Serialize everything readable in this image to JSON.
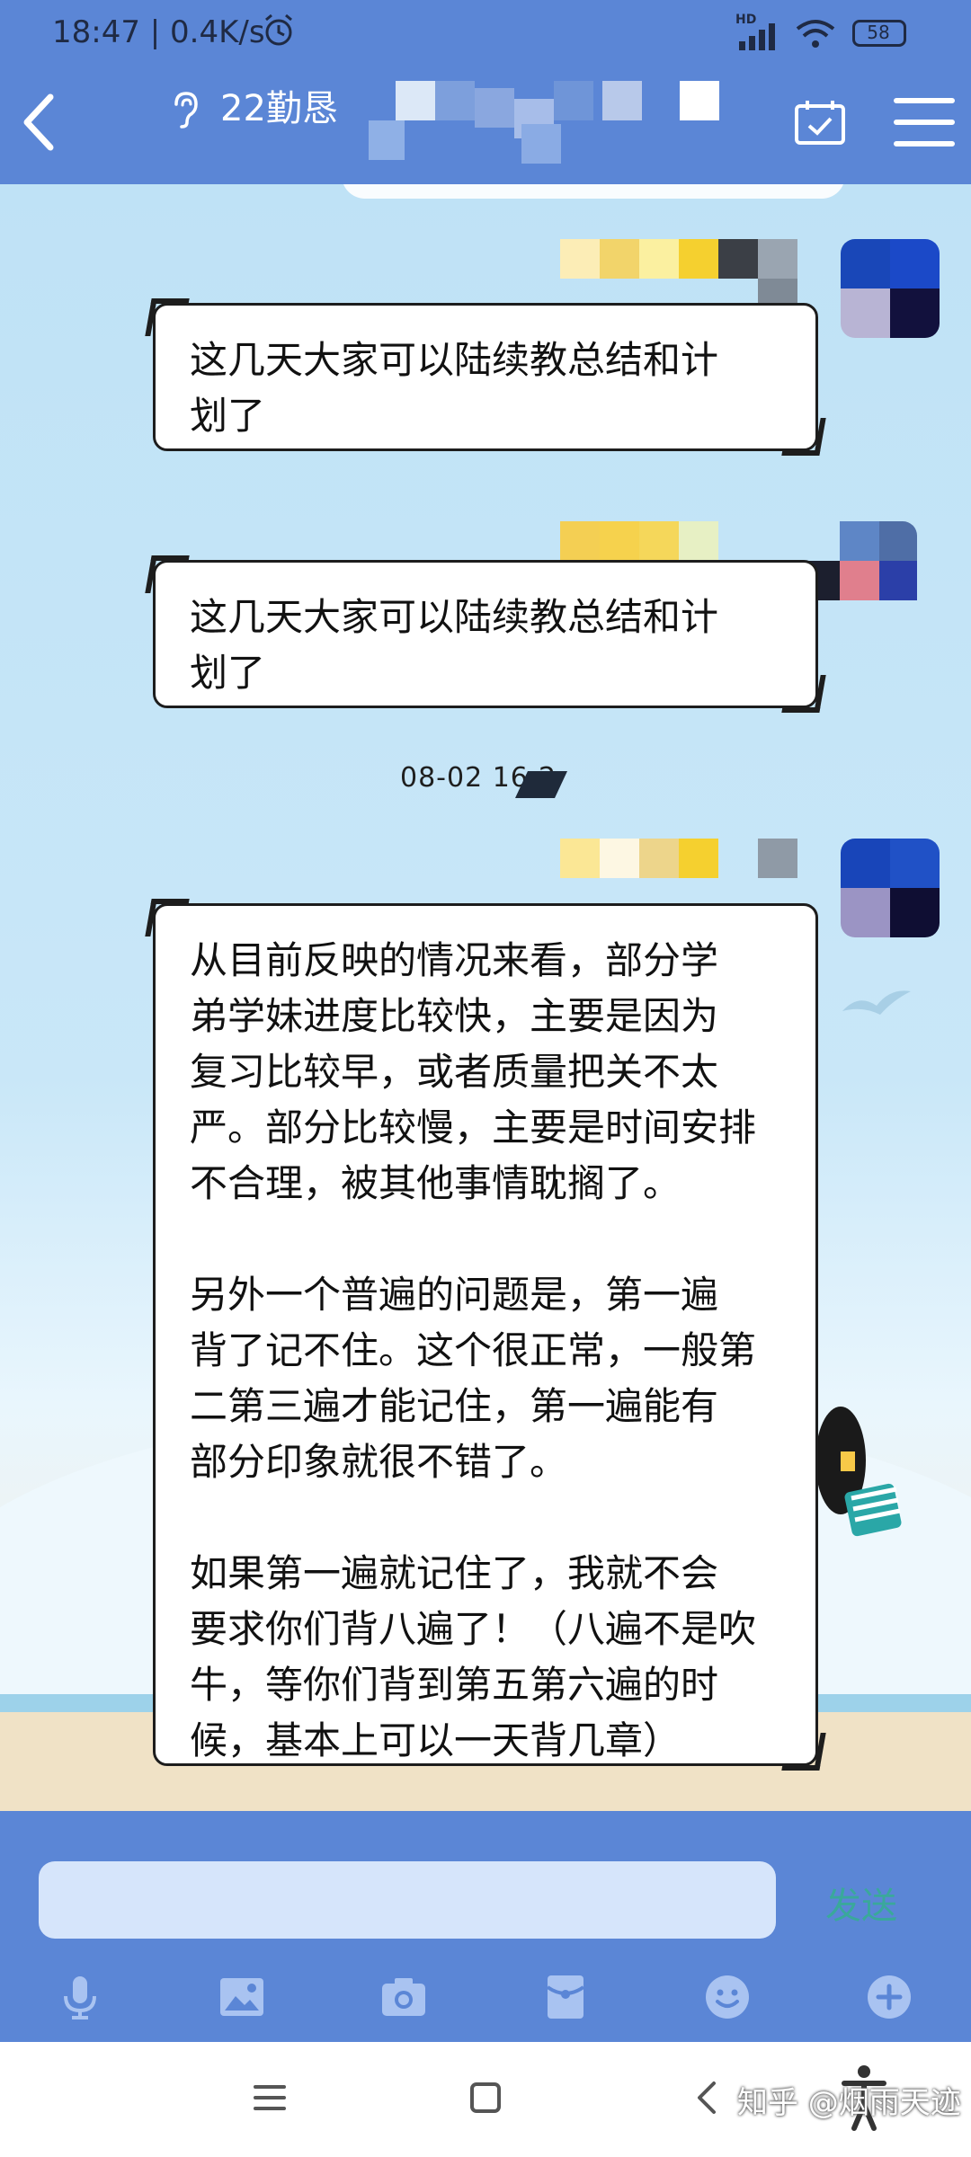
{
  "status_bar": {
    "time": "18:47 | 0.4K/s",
    "network": "HD",
    "battery": "58"
  },
  "header": {
    "title": "22勤恳"
  },
  "messages": [
    {
      "type": "bubble",
      "text": "这几天大家可以陆续教总结和计\n划了"
    },
    {
      "type": "bubble",
      "text": "这几天大家可以陆续教总结和计\n划了"
    },
    {
      "type": "timestamp",
      "text": "08-02 16:2"
    },
    {
      "type": "bubble",
      "text": "从目前反映的情况来看，部分学\n弟学妹进度比较快，主要是因为\n复习比较早，或者质量把关不太\n严。部分比较慢，主要是时间安排\n不合理，被其他事情耽搁了。\n\n另外一个普遍的问题是，第一遍\n背了记不住。这个很正常，一般第\n二第三遍才能记住，第一遍能有\n部分印象就很不错了。\n\n如果第一遍就记住了，我就不会\n要求你们背八遍了！（八遍不是吹\n牛，等你们背到第五第六遍的时\n候，基本上可以一天背几章）"
    }
  ],
  "input": {
    "placeholder": "",
    "send_label": "发送"
  },
  "toolbar": {
    "icons": [
      "microphone-icon",
      "image-icon",
      "camera-icon",
      "red-envelope-icon",
      "emoji-icon",
      "plus-icon"
    ]
  },
  "watermark": "知乎 @烟雨天迹",
  "colors": {
    "header_bg": "#5b86d6",
    "chat_bg": "#bfe2f6",
    "send_text": "#3aa89b",
    "input_bg": "#d6e5fb"
  }
}
